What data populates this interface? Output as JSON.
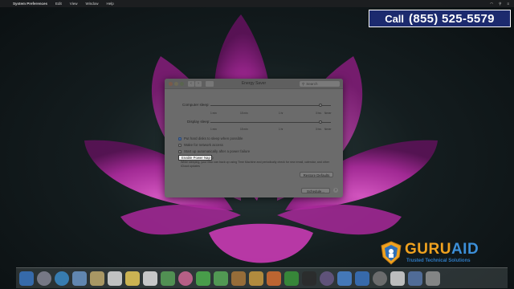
{
  "menubar": {
    "app_name": "System Preferences",
    "items": [
      "Edit",
      "View",
      "Window",
      "Help"
    ]
  },
  "banner": {
    "call_label": "Call",
    "phone": "(855)  525-5579"
  },
  "window": {
    "title": "Energy Saver",
    "search_placeholder": "Search",
    "computer_sleep_label": "Computer sleep:",
    "display_sleep_label": "Display sleep:",
    "computer_sleep_ticks": [
      "1 min",
      "15 min",
      "1 hr",
      "3 hrs",
      "Never"
    ],
    "display_sleep_ticks": [
      "1 min",
      "15 min",
      "1 hr",
      "3 hrs",
      "Never"
    ],
    "computer_sleep_level": 0.92,
    "display_sleep_level": 0.92,
    "options": [
      {
        "label": "Put hard disks to sleep when possible",
        "checked": true
      },
      {
        "label": "Wake for network access",
        "checked": false
      },
      {
        "label": "Start up automatically after a power failure",
        "checked": false
      },
      {
        "label": "Enable Power Nap",
        "checked": false
      }
    ],
    "power_nap_desc": "While sleeping, your Mac can back up using Time Machine and periodically check for new email, calendar, and other iCloud updates",
    "restore_defaults_label": "Restore Defaults",
    "schedule_label": "Schedule...",
    "help_label": "?"
  },
  "logo": {
    "brand_guru": "GURU",
    "brand_aid": "AID",
    "tagline": "Trusted Technical Solutions"
  },
  "colors": {
    "banner_bg": "#1c2a6e",
    "logo_orange": "#f0a21f",
    "logo_blue": "#3c8fd8"
  }
}
